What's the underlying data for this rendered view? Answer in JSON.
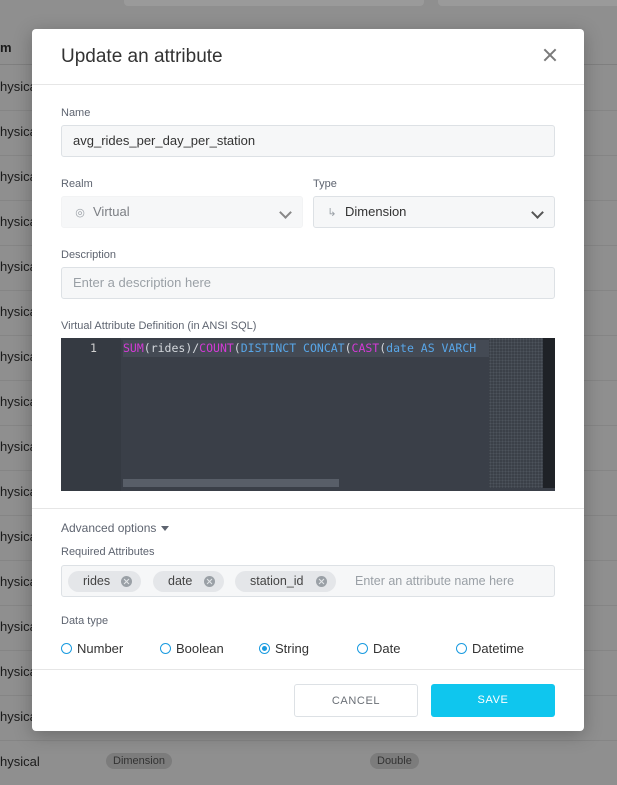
{
  "background": {
    "column_header": "m",
    "rows": [
      "hysical",
      "hysica",
      "hysica",
      "hysica",
      "hysica",
      "hysica",
      "hysica",
      "hysica",
      "hysica",
      "hysica",
      "hysica",
      "hysica",
      "hysica",
      "hysica",
      "hysica"
    ],
    "last_row": "hysical",
    "pills": [
      "Dimension",
      "Double"
    ]
  },
  "modal": {
    "title": "Update an attribute",
    "name_label": "Name",
    "name_value": "avg_rides_per_day_per_station",
    "realm_label": "Realm",
    "realm_value": "Virtual",
    "realm_icon": "globe-icon",
    "type_label": "Type",
    "type_value": "Dimension",
    "type_icon": "dimension-icon",
    "description_label": "Description",
    "description_placeholder": "Enter a description here",
    "definition_label": "Virtual Attribute Definition (in ANSI SQL)",
    "code": {
      "line_number": "1",
      "tokens": {
        "t1": "SUM",
        "t2": "(rides)/",
        "t3": "COUNT",
        "t4": "(",
        "t5": "DISTINCT CONCAT",
        "t6": "(",
        "t7": "CAST",
        "t8": "(",
        "t9": "date AS VARCH"
      }
    },
    "advanced_options": "Advanced options",
    "required_label": "Required Attributes",
    "required_tags": [
      "rides",
      "date",
      "station_id"
    ],
    "required_placeholder": "Enter an attribute name here",
    "datatype_label": "Data type",
    "datatypes": [
      "Number",
      "Boolean",
      "String",
      "Date",
      "Datetime"
    ],
    "datatype_selected": "String",
    "cancel_label": "CANCEL",
    "save_label": "SAVE",
    "colors": {
      "accent": "#0fc6ee",
      "radio": "#1a9be0",
      "editor_bg": "#3a3f48"
    }
  }
}
